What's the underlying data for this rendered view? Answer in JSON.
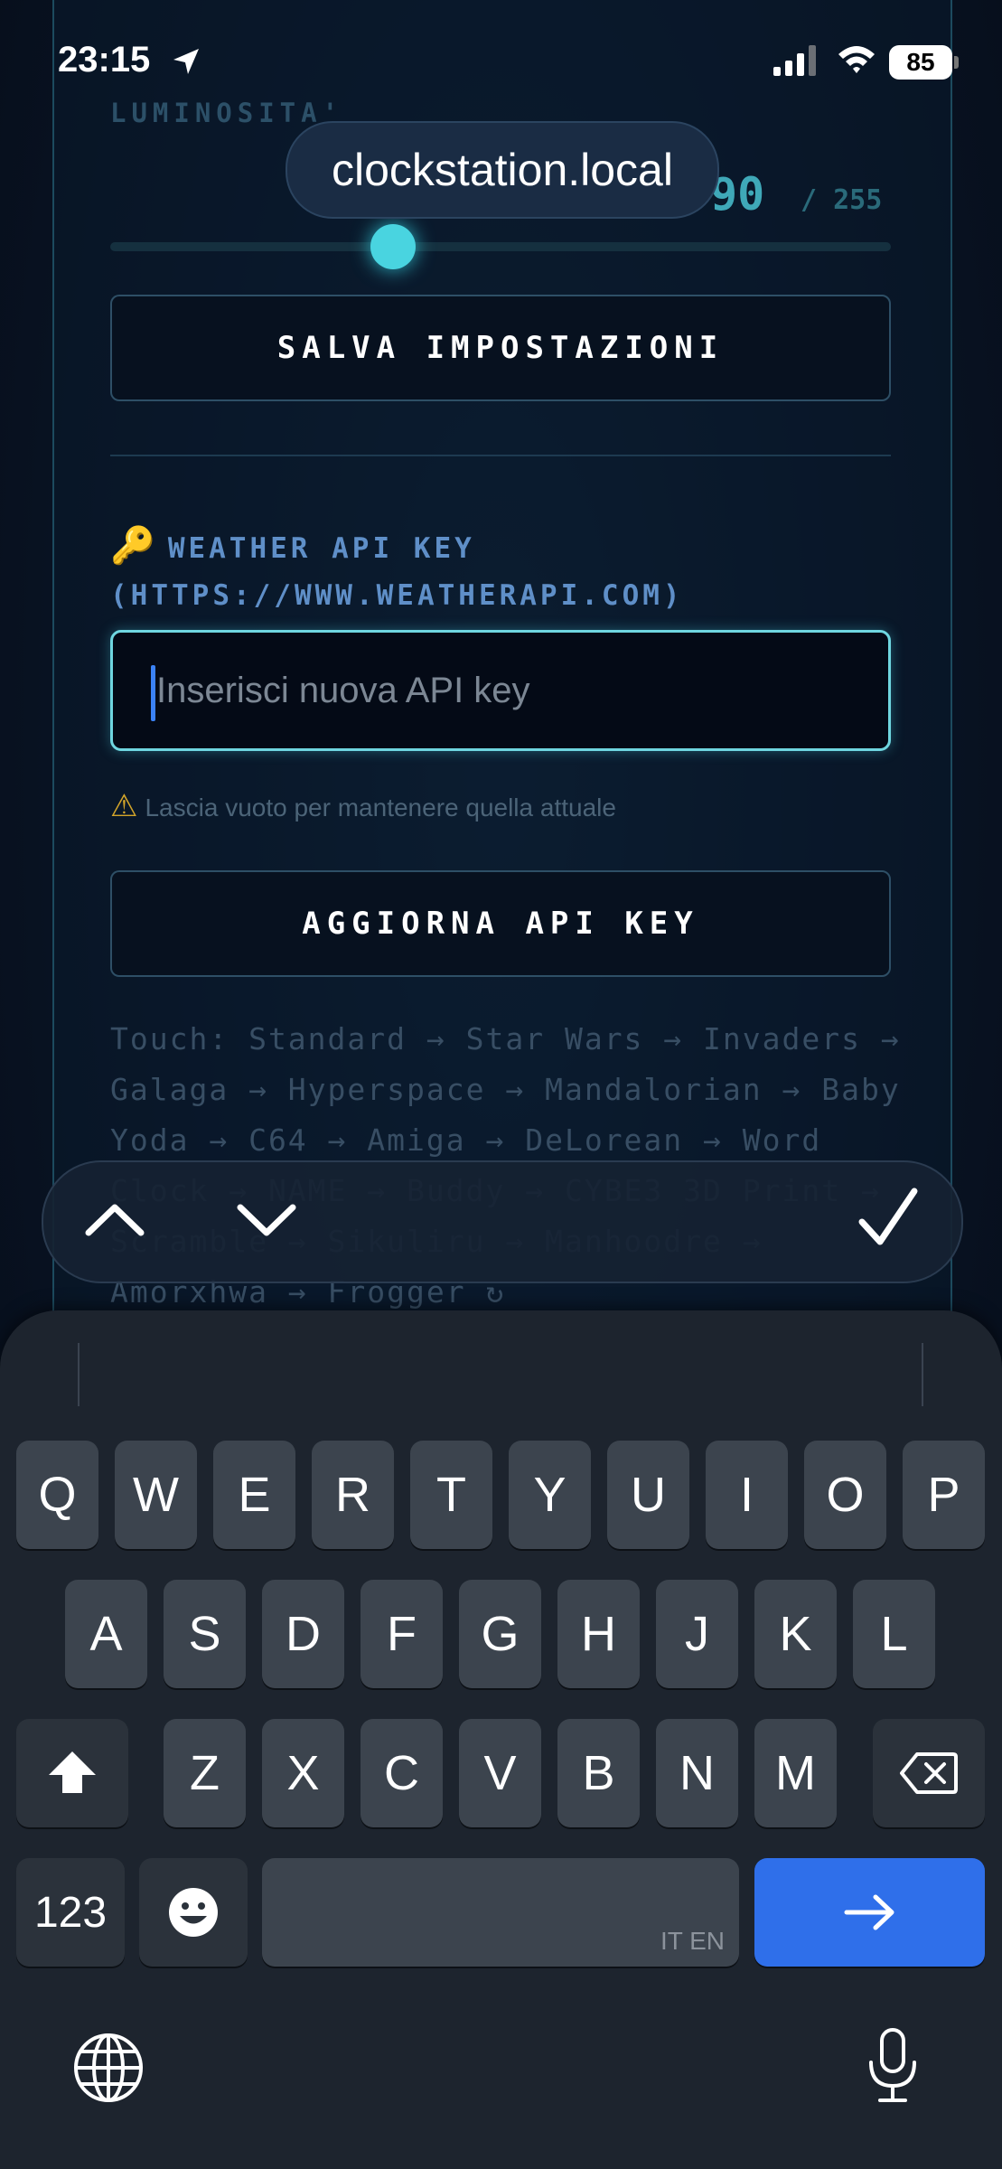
{
  "status_bar": {
    "time": "23:15",
    "battery": "85"
  },
  "browser": {
    "url": "clockstation.local"
  },
  "brightness": {
    "label": "LUMINOSITA'",
    "value": "90",
    "max": "/ 255",
    "fraction": 0.353
  },
  "buttons": {
    "save_settings": "SALVA IMPOSTAZIONI",
    "update_api": "AGGIORNA API KEY"
  },
  "weather_api": {
    "key_emoji": "🔑",
    "label": "WEATHER API KEY",
    "url": "(HTTPS://WWW.WEATHERAPI.COM)",
    "placeholder": "Inserisci nuova API key",
    "hint_icon": "⚠",
    "hint": "Lascia vuoto per mantenere quella attuale"
  },
  "touch_text": "Touch: Standard → Star Wars → Invaders → Galaga → Hyperspace → Mandalorian → Baby Yoda → C64 → Amiga → DeLorean → Word Clock → NAME → Buddy → CYBE3 3D Print → Scramble → Sikuliru → Manhoodre → Amorxhwa → Frogger ↻",
  "toolbar": {
    "up_icon": "chevron-up-icon",
    "down_icon": "chevron-down-icon",
    "done_icon": "checkmark-icon"
  },
  "keyboard": {
    "row1": [
      "Q",
      "W",
      "E",
      "R",
      "T",
      "Y",
      "U",
      "I",
      "O",
      "P"
    ],
    "row2": [
      "A",
      "S",
      "D",
      "F",
      "G",
      "H",
      "J",
      "K",
      "L"
    ],
    "row3": [
      "Z",
      "X",
      "C",
      "V",
      "B",
      "N",
      "M"
    ],
    "numbers": "123",
    "emoji": "☺",
    "lang": "IT EN",
    "colors": {
      "key": "#3c444e",
      "go": "#2f6fea"
    }
  }
}
